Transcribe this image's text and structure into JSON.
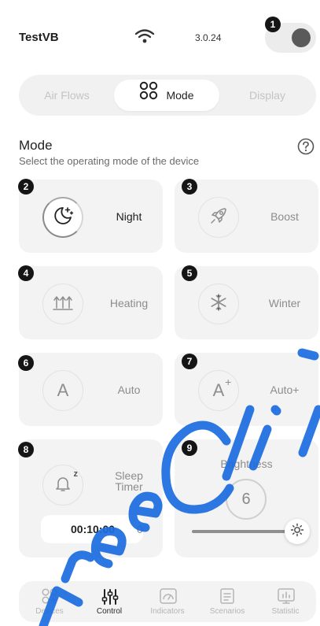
{
  "header": {
    "device_name": "TestVB",
    "version": "3.0.24",
    "badge": "1"
  },
  "tabs": [
    {
      "label": "Air Flows",
      "active": false
    },
    {
      "label": "Mode",
      "active": true
    },
    {
      "label": "Display",
      "active": false
    }
  ],
  "section": {
    "title": "Mode",
    "subtitle": "Select the operating mode of the device"
  },
  "modes": [
    {
      "badge": "2",
      "label": "Night",
      "icon": "moon-stars-icon",
      "active": true
    },
    {
      "badge": "3",
      "label": "Boost",
      "icon": "rocket-icon",
      "active": false
    },
    {
      "badge": "4",
      "label": "Heating",
      "icon": "heat-waves-icon",
      "active": false
    },
    {
      "badge": "5",
      "label": "Winter",
      "icon": "snowflake-icon",
      "active": false
    },
    {
      "badge": "6",
      "label": "Auto",
      "icon_text": "A",
      "active": false
    },
    {
      "badge": "7",
      "label": "Auto+",
      "icon_text": "A",
      "icon_sup": "+",
      "active": false
    }
  ],
  "sleep_timer": {
    "badge": "8",
    "label_line1": "Sleep",
    "label_line2": "Timer",
    "icon_sup": "z",
    "value": "00:10:00",
    "extra": "0"
  },
  "brightness": {
    "badge": "9",
    "label": "Brightness",
    "value": "6"
  },
  "nav": [
    {
      "label": "Devices",
      "active": false
    },
    {
      "label": "Control",
      "active": true
    },
    {
      "label": "Indicators",
      "active": false
    },
    {
      "label": "Scenarios",
      "active": false
    },
    {
      "label": "Statistic",
      "active": false
    }
  ],
  "colors": {
    "card_bg": "#f3f3f3",
    "badge_bg": "#151515",
    "watermark": "#1b6ce0"
  }
}
